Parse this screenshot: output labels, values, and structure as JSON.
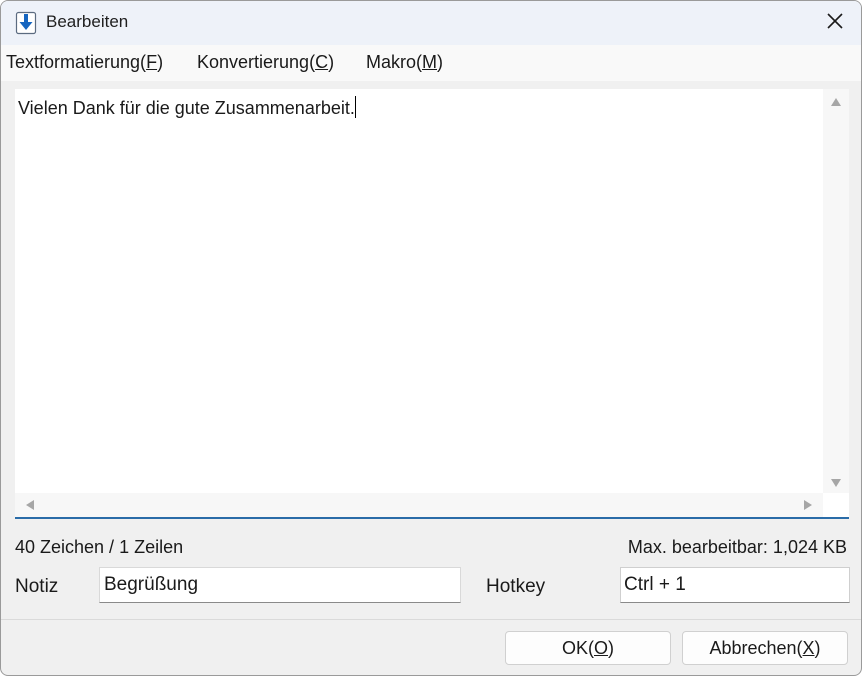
{
  "window": {
    "title": "Bearbeiten",
    "icons": {
      "app": "download-arrow-icon",
      "close": "close-icon"
    }
  },
  "menu": [
    {
      "label": "Textformatierung(",
      "key": "F",
      "suffix": ")"
    },
    {
      "label": "Konvertierung(",
      "key": "C",
      "suffix": ")"
    },
    {
      "label": "Makro(",
      "key": "M",
      "suffix": ")"
    }
  ],
  "editor": {
    "text": "Vielen Dank für die gute Zusammenarbeit."
  },
  "status": {
    "count": "40 Zeichen / 1 Zeilen",
    "max": "Max. bearbeitbar: 1,024 KB"
  },
  "fields": {
    "note_label": "Notiz",
    "note_value": "Begrüßung",
    "hotkey_label": "Hotkey",
    "hotkey_value": "Ctrl + 1"
  },
  "buttons": {
    "ok": {
      "label": "OK(",
      "key": "O",
      "suffix": ")"
    },
    "cancel": {
      "label": "Abbrechen(",
      "key": "X",
      "suffix": ")"
    }
  },
  "colors": {
    "accent": "#2a6ca8",
    "icon_blue": "#1565c0",
    "titlebar": "#eef2f9"
  }
}
